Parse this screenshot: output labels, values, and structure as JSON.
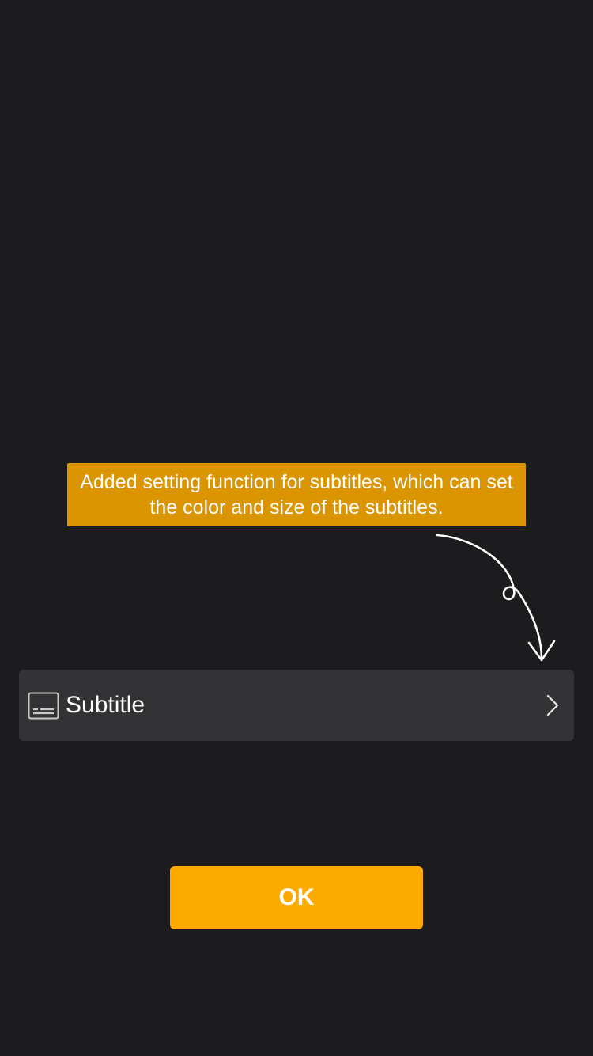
{
  "tooltip": {
    "text": "Added setting function for subtitles, which can set the color and size of the subtitles."
  },
  "settings": {
    "subtitle_label": "Subtitle",
    "subtitle_icon": "subtitle-icon",
    "chevron_icon": "chevron-right-icon"
  },
  "actions": {
    "ok_label": "OK"
  },
  "colors": {
    "background": "#1c1b1d",
    "tooltip_background": "#db9500",
    "row_background": "#333235",
    "accent": "#fdab00",
    "text": "#ffffff"
  }
}
